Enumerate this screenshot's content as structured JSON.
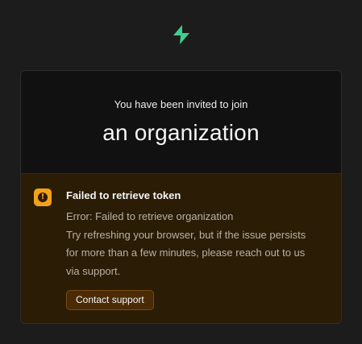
{
  "brand": {
    "logo_icon": "supabase-bolt-icon",
    "accent_color": "#3ecf8e"
  },
  "invite": {
    "intro": "You have been invited to join",
    "organization": "an organization"
  },
  "alert": {
    "icon": "exclamation-icon",
    "color": "#f3a216",
    "title": "Failed to retrieve token",
    "lines": [
      "Error: Failed to retrieve organization",
      "Try refreshing your browser, but if the issue persists",
      "for more than a few minutes, please reach out to us",
      "via support."
    ],
    "button_label": "Contact support"
  }
}
